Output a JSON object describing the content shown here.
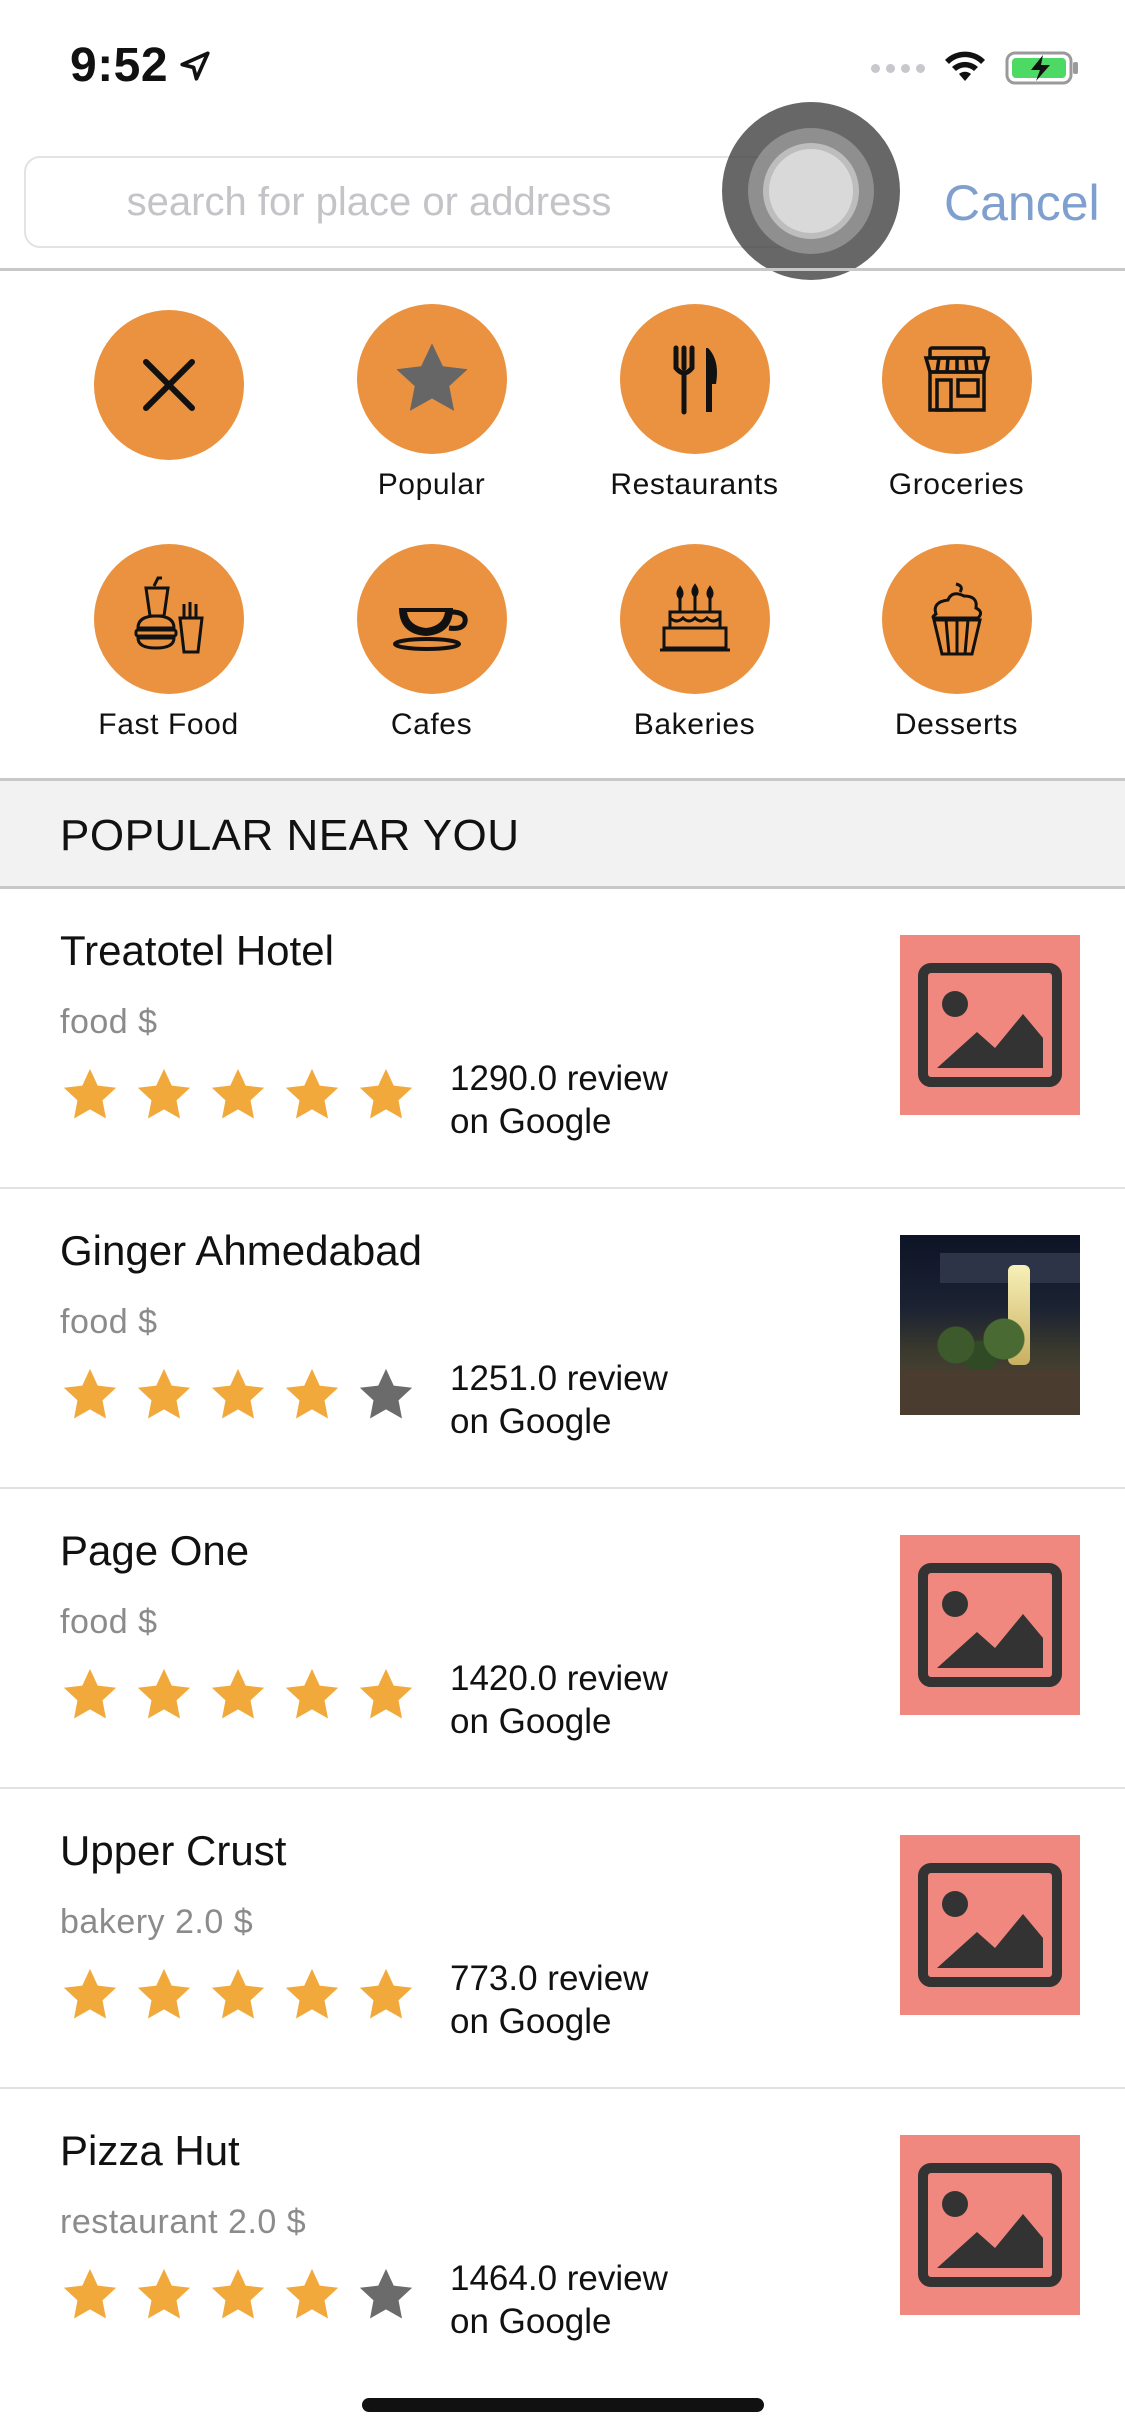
{
  "status_bar": {
    "time": "9:52"
  },
  "search": {
    "placeholder": "search for place or address",
    "value": "",
    "cancel_label": "Cancel"
  },
  "categories": [
    {
      "label": "",
      "icon": "close-icon"
    },
    {
      "label": "Popular",
      "icon": "star-icon"
    },
    {
      "label": "Restaurants",
      "icon": "fork-knife-icon"
    },
    {
      "label": "Groceries",
      "icon": "store-icon"
    },
    {
      "label": "Fast Food",
      "icon": "fast-food-icon"
    },
    {
      "label": "Cafes",
      "icon": "coffee-cup-icon"
    },
    {
      "label": "Bakeries",
      "icon": "cake-icon"
    },
    {
      "label": "Desserts",
      "icon": "cupcake-icon"
    }
  ],
  "section": {
    "title": "POPULAR NEAR YOU"
  },
  "places": [
    {
      "name": "Treatotel Hotel",
      "meta": "food  $",
      "rating": 5,
      "review_line1": "1290.0 review",
      "review_line2": "on Google",
      "image": "placeholder"
    },
    {
      "name": "Ginger Ahmedabad",
      "meta": "food  $",
      "rating": 4,
      "review_line1": "1251.0 review",
      "review_line2": "on Google",
      "image": "photo"
    },
    {
      "name": "Page One",
      "meta": "food  $",
      "rating": 5,
      "review_line1": "1420.0 review",
      "review_line2": "on Google",
      "image": "placeholder"
    },
    {
      "name": "Upper Crust",
      "meta": "bakery 2.0 $",
      "rating": 5,
      "review_line1": "773.0 review",
      "review_line2": "on Google",
      "image": "placeholder"
    },
    {
      "name": "Pizza Hut",
      "meta": "restaurant 2.0 $",
      "rating": 4,
      "review_line1": "1464.0 review",
      "review_line2": "on Google",
      "image": "placeholder"
    }
  ],
  "colors": {
    "accent_orange": "#ea9240",
    "star_filled": "#f2a93b",
    "star_empty": "#6b6b6b",
    "placeholder_bg": "#f08880",
    "cancel_blue": "#7fa0cf"
  }
}
